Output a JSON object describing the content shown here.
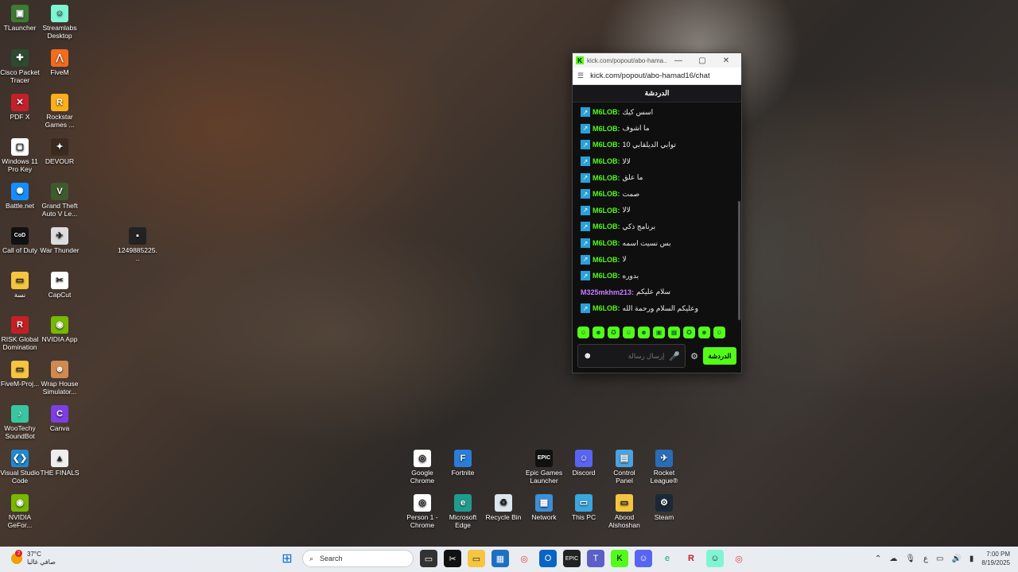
{
  "desktop_icons": [
    {
      "label": "TLauncher",
      "color": "#3d7a34",
      "glyph": "▣"
    },
    {
      "label": "Streamlabs Desktop",
      "color": "#80f5d2",
      "glyph": "☺"
    },
    {
      "label": "Cisco Packet Tracer",
      "color": "#2e4a2e",
      "glyph": "✚"
    },
    {
      "label": "FiveM",
      "color": "#f46b1e",
      "glyph": "⋀"
    },
    {
      "label": "PDF X",
      "color": "#c4202a",
      "glyph": "✕"
    },
    {
      "label": "Rockstar Games ...",
      "color": "#fcaf17",
      "glyph": "R"
    },
    {
      "label": "Windows 11 Pro Key",
      "color": "#ffffff",
      "glyph": "▢"
    },
    {
      "label": "DEVOUR",
      "color": "#3a2a20",
      "glyph": "✦"
    },
    {
      "label": "Battle.net",
      "color": "#148eff",
      "glyph": "✺"
    },
    {
      "label": "Grand Theft Auto V Le...",
      "color": "#3e5a2e",
      "glyph": "V"
    },
    {
      "label": "Call of Duty",
      "color": "#111111",
      "glyph": "CoD"
    },
    {
      "label": "War Thunder",
      "color": "#dddddd",
      "glyph": "✈"
    },
    {
      "label": "1249885225...",
      "color": "#222222",
      "glyph": "▪"
    },
    {
      "label": "نسة",
      "color": "#f5c542",
      "glyph": "▭"
    },
    {
      "label": "CapCut",
      "color": "#ffffff",
      "glyph": "✂"
    },
    {
      "label": "RISK Global Domination",
      "color": "#c51f25",
      "glyph": "R"
    },
    {
      "label": "NVIDIA App",
      "color": "#76b900",
      "glyph": "◉"
    },
    {
      "label": "FiveM-Proj...",
      "color": "#f5c542",
      "glyph": "▭"
    },
    {
      "label": "Wrap House Simulator...",
      "color": "#d08a50",
      "glyph": "☻"
    },
    {
      "label": "WooTechy SoundBot",
      "color": "#37c7a0",
      "glyph": "♪"
    },
    {
      "label": "Canva",
      "color": "#7b3fe4",
      "glyph": "C"
    },
    {
      "label": "Visual Studio Code",
      "color": "#1f8ad2",
      "glyph": "❮❯"
    },
    {
      "label": "THE FINALS",
      "color": "#eeeeee",
      "glyph": "▲"
    },
    {
      "label": "NVIDIA GeFor...",
      "color": "#76b900",
      "glyph": "◉"
    },
    {
      "label": "Google Chrome",
      "color": "#ffffff",
      "glyph": "◎"
    },
    {
      "label": "Fortnite",
      "color": "#2a7dd8",
      "glyph": "F"
    },
    {
      "label": "Epic Games Launcher",
      "color": "#111111",
      "glyph": "EPIC"
    },
    {
      "label": "Discord",
      "color": "#5865f2",
      "glyph": "☺"
    },
    {
      "label": "Control Panel",
      "color": "#4aa3df",
      "glyph": "▤"
    },
    {
      "label": "Rocket League®",
      "color": "#2b6cb8",
      "glyph": "✈"
    },
    {
      "label": "Person 1 - Chrome",
      "color": "#ffffff",
      "glyph": "◎"
    },
    {
      "label": "Microsoft Edge",
      "color": "#1f9c8e",
      "glyph": "e"
    },
    {
      "label": "Recycle Bin",
      "color": "#dde6ee",
      "glyph": "♻"
    },
    {
      "label": "Network",
      "color": "#3c8fd8",
      "glyph": "▦"
    },
    {
      "label": "This PC",
      "color": "#3aa6e0",
      "glyph": "▭"
    },
    {
      "label": "Abood Alshoshan",
      "color": "#f5c542",
      "glyph": "▭"
    },
    {
      "label": "Steam",
      "color": "#1b2838",
      "glyph": "⚙"
    }
  ],
  "browser": {
    "title": "kick.com/popout/abo-hama...",
    "url": "kick.com/popout/abo-hamad16/chat",
    "chat_header": "الدردشة",
    "messages": [
      {
        "user": "M6LOB",
        "text": "اسس كيك",
        "purple": false
      },
      {
        "user": "M6LOB",
        "text": "ما اشوف",
        "purple": false
      },
      {
        "user": "M6LOB",
        "text": "توابي الديلقابي 10",
        "purple": false
      },
      {
        "user": "M6LOB",
        "text": "لالا",
        "purple": false
      },
      {
        "user": "M6LOB",
        "text": "ما علق",
        "purple": false
      },
      {
        "user": "M6LOB",
        "text": "صمت",
        "purple": false
      },
      {
        "user": "M6LOB",
        "text": "لالا",
        "purple": false
      },
      {
        "user": "M6LOB",
        "text": "برنامج ذكي",
        "purple": false
      },
      {
        "user": "M6LOB",
        "text": "بس نسيت اسمه",
        "purple": false
      },
      {
        "user": "M6LOB",
        "text": "لا",
        "purple": false
      },
      {
        "user": "M6LOB",
        "text": "بدوره",
        "purple": false
      },
      {
        "user": "M325mkhm213",
        "text": "سلام عليكم",
        "purple": true
      },
      {
        "user": "M6LOB",
        "text": "وعليكم السلام ورحمة الله",
        "purple": false
      }
    ],
    "emotes": [
      "☺",
      "☻",
      "✪",
      "☺",
      "☻",
      "▣",
      "▦",
      "✪",
      "☻",
      "☺"
    ],
    "input_placeholder": "إرسال رسالة",
    "send_label": "الدردشة",
    "minimize": "—",
    "maximize": "▢",
    "close": "✕"
  },
  "taskbar": {
    "weather_temp": "37°C",
    "weather_desc": "صافي غالبا",
    "weather_badge": "2",
    "search_label": "Search",
    "time": "7:00 PM",
    "date": "8/19/2025",
    "lang": "ع"
  }
}
